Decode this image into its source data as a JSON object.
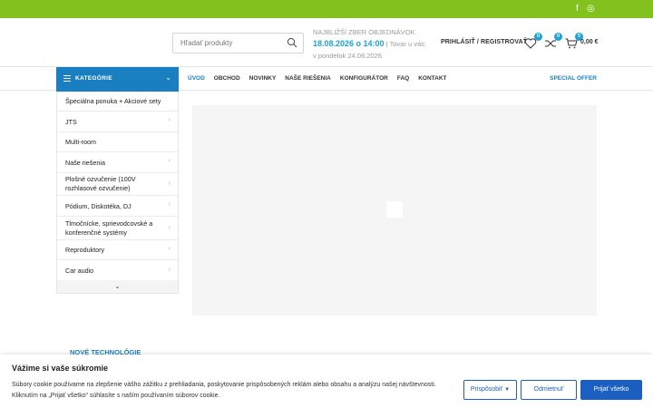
{
  "topbar": {
    "social": [
      {
        "icon": "facebook-icon",
        "glyph": "f"
      },
      {
        "icon": "instagram-icon",
        "glyph": "◎"
      }
    ],
    "color": "#83c11f"
  },
  "header": {
    "search": {
      "placeholder": "Hľadať produkty"
    },
    "shipping": {
      "heading": "NAJBLIŽŠÍ ZBER OBJEDNÁVOK",
      "date": "18.08.2026 o 14:00",
      "suffix": "Tovar u vás: v pondelok 24.08.2026"
    },
    "login_label": "PRIHLÁSIŤ / REGISTROVAŤ",
    "wishlist_count": "0",
    "compare_count": "0",
    "cart_count": "0",
    "cart_total": "0,00 €"
  },
  "nav": {
    "categories_label": "KATEGÓRIE",
    "items": [
      "ÚVOD",
      "OBCHOD",
      "NOVINKY",
      "NAŠE RIEŠENIA",
      "KONFIGURÁTOR",
      "FAQ",
      "KONTAKT"
    ],
    "special": "SPECIAL OFFER",
    "accent": "#1a7fc1"
  },
  "sidebar": {
    "items": [
      "Špeciálna ponuka + Akciové sety",
      "JTS",
      "Multi-room",
      "Naše riešenia",
      "Plošné ozvučenie (100V rozhlasové ozvučenie)",
      "Pódium, Diskotéka, DJ",
      "Tlmočnícke, sprievodcovské a konferenčné systémy",
      "Reproduktory",
      "Car audio"
    ]
  },
  "section_title": "NOVÉ TECHNOLÓGIE",
  "cookie": {
    "title": "Vážime si vaše súkromie",
    "text": "Súbory cookie používame na zlepšenie vášho zážitku z prehliadania, poskytovanie prispôsobených reklám alebo obsahu a analýzu našej návštevnosti. Kliknutím na „Prijať všetko“ súhlasíte s naším používaním súborov cookie.",
    "customize": "Prispôsobiť",
    "reject": "Odmietnuť",
    "accept": "Prijať všetko"
  }
}
